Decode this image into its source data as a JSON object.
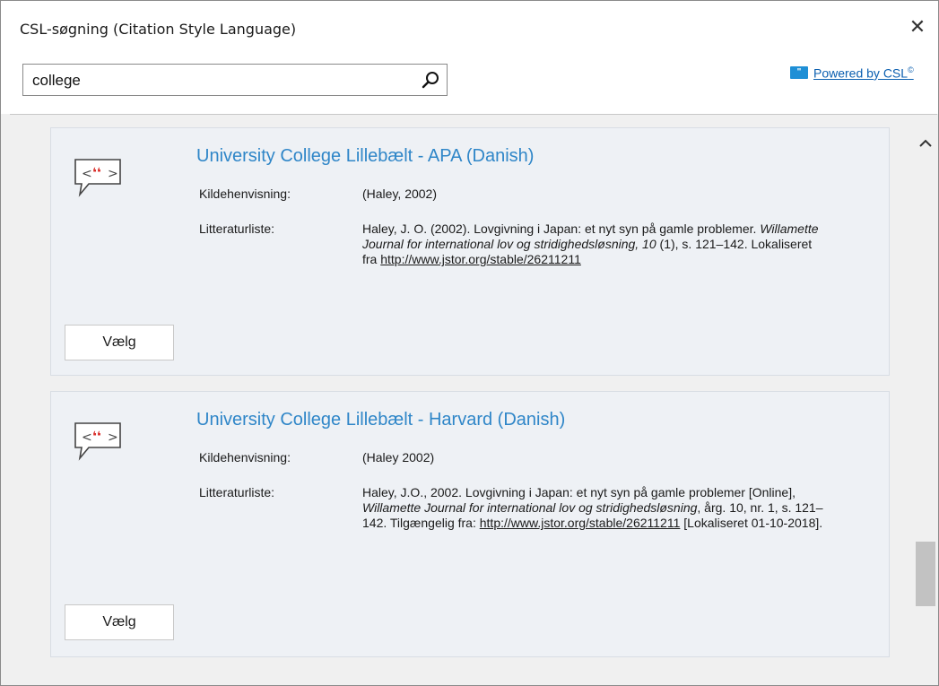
{
  "window": {
    "title": "CSL-søgning (Citation Style Language)",
    "close_symbol": "✕"
  },
  "search": {
    "value": "college",
    "icon": "search-icon"
  },
  "powered": {
    "logo_text": "\"",
    "label": "Powered by CSL",
    "mark": "©"
  },
  "results": [
    {
      "name": "University College Lillebælt - APA (Danish)",
      "citation_label": "Kildehenvisning:",
      "citation_value": "(Haley, 2002)",
      "bibliography_label": "Litteraturliste:",
      "bibliography_part1": "Haley, J. O. (2002). Lovgivning i Japan: et nyt syn på gamle problemer. ",
      "bibliography_italic": "Willamette Journal for international lov og stridighedsløsning, 10",
      "bibliography_part2": " (1), s. 121–142. Lokaliseret fra ",
      "bibliography_link": "http://www.jstor.org/stable/26211211",
      "choose_label": "Vælg"
    },
    {
      "name": "University College Lillebælt - Harvard (Danish)",
      "citation_label": "Kildehenvisning:",
      "citation_value": "(Haley 2002)",
      "bibliography_label": "Litteraturliste:",
      "bibliography_part1": "Haley, J.O., 2002. Lovgivning i Japan: et nyt syn på gamle problemer [Online], ",
      "bibliography_italic": "Willamette Journal for international lov og stridighedsløsning",
      "bibliography_part2": ", årg. 10, nr. 1, s. 121–142. Tilgængelig fra: ",
      "bibliography_link": "http://www.jstor.org/stable/26211211",
      "bibliography_part3": " [Lokaliseret 01-10-2018].",
      "choose_label": "Vælg"
    }
  ],
  "colors": {
    "accent": "#2f86c8",
    "quote_red": "#d9302c",
    "card_bg": "#eef1f5"
  }
}
